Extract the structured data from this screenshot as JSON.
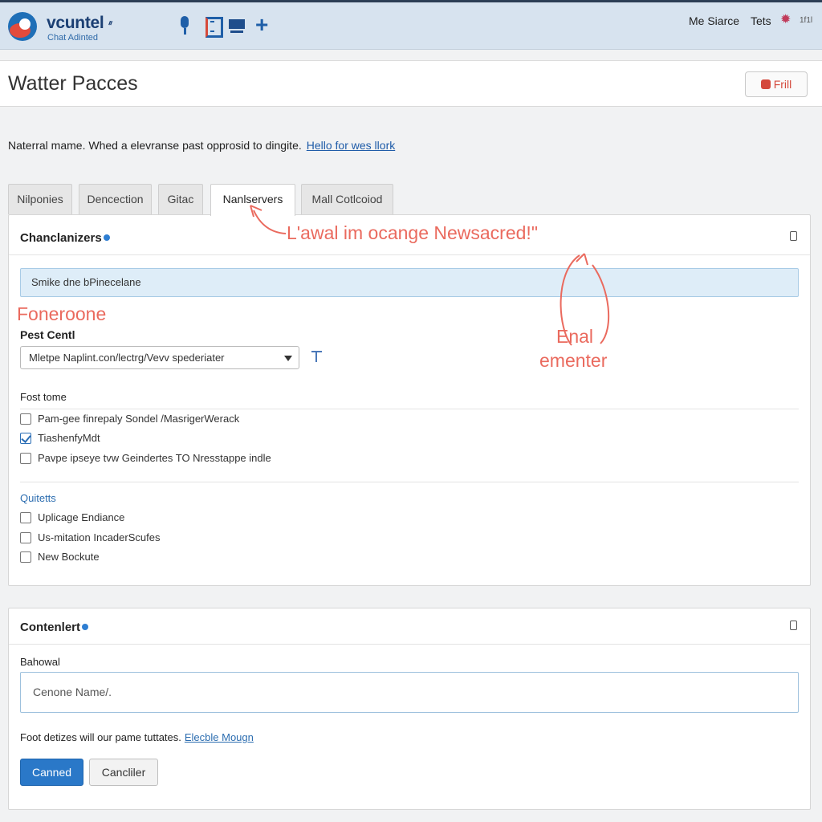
{
  "topbar": {
    "brand": "vcuntel",
    "brand_mark": "ᐥ",
    "brand_sub": "Chat Adinted",
    "icons": [
      "microphone-icon",
      "document-icon",
      "monitor-icon",
      "plus-icon"
    ],
    "plus": "+",
    "user": "Me Siarce",
    "tests": "Tets",
    "gear": "✹",
    "tiny": "1f1l"
  },
  "page": {
    "title": "Watter Pacces",
    "full_label": "Frill"
  },
  "notice": {
    "text": "Naterral mame. Whed a elevranse past opprosid to dingite.",
    "link": "Hello for wes llork"
  },
  "tabs": [
    {
      "label": "Nilponies"
    },
    {
      "label": "Dencection"
    },
    {
      "label": "Gitac"
    },
    {
      "label": "Nanlservers",
      "active": true
    },
    {
      "label": "Mall Cotlcoiod"
    }
  ],
  "card1": {
    "title": "Chanclanizers",
    "info_bar": "Smike dne bPinecelane",
    "annotations": {
      "orange_note": "L'awal im ocange Newsacred!\"",
      "red_label": "Foneroone",
      "email_line1": "Enal",
      "email_line2": "ementer"
    },
    "field_label": "Pest Centl",
    "select_value": "Mletpe Naplint.con/lectrg/Vevv spederiater",
    "group1_label": "Fost tome",
    "group1": [
      {
        "label": "Pam-gee finrepaly Sondel /MasrigerWerack",
        "checked": false
      },
      {
        "label": "TiashenfyMdt",
        "checked": true
      },
      {
        "label": "Pavpe ipseye tvw Geindertes TO Nresstappe indle",
        "checked": false
      }
    ],
    "group2_label": "Quitetts",
    "group2": [
      {
        "label": "Uplicage Endiance",
        "checked": false
      },
      {
        "label": "Us-mitation IncaderScufes",
        "checked": false
      },
      {
        "label": "New Bockute",
        "checked": false
      }
    ]
  },
  "card2": {
    "title": "Contenlert",
    "field_label": "Bahowal",
    "placeholder": "Cenone Name/.",
    "footnote": "Foot detizes will our pame tuttates.",
    "footnote_link": "Elecble Mougn",
    "primary_button": "Canned",
    "secondary_button": "Cancliler"
  },
  "colors": {
    "accent": "#2a78c8",
    "annotation": "#ea6a5e",
    "topbar": "#d7e3ef"
  }
}
